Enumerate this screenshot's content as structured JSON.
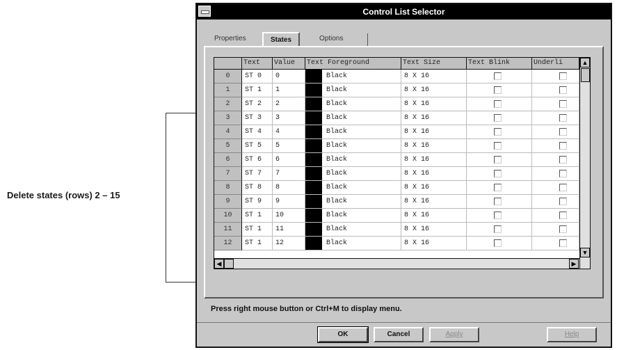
{
  "annotation": {
    "label": "Delete states (rows) 2 – 15"
  },
  "window": {
    "title": "Control List Selector"
  },
  "tabs": [
    {
      "label": "Properties"
    },
    {
      "label": "States"
    },
    {
      "label": "Options"
    }
  ],
  "grid": {
    "columns": [
      "Text",
      "Value",
      "Text Foreground",
      "Text Size",
      "Text Blink",
      "Underli"
    ],
    "rows": [
      {
        "index": "0",
        "text": "ST 0",
        "value": "0",
        "fg": "Black",
        "size": "8 X 16"
      },
      {
        "index": "1",
        "text": "ST 1",
        "value": "1",
        "fg": "Black",
        "size": "8 X 16"
      },
      {
        "index": "2",
        "text": "ST 2",
        "value": "2",
        "fg": "Black",
        "size": "8 X 16"
      },
      {
        "index": "3",
        "text": "ST 3",
        "value": "3",
        "fg": "Black",
        "size": "8 X 16"
      },
      {
        "index": "4",
        "text": "ST 4",
        "value": "4",
        "fg": "Black",
        "size": "8 X 16"
      },
      {
        "index": "5",
        "text": "ST 5",
        "value": "5",
        "fg": "Black",
        "size": "8 X 16"
      },
      {
        "index": "6",
        "text": "ST 6",
        "value": "6",
        "fg": "Black",
        "size": "8 X 16"
      },
      {
        "index": "7",
        "text": "ST 7",
        "value": "7",
        "fg": "Black",
        "size": "8 X 16"
      },
      {
        "index": "8",
        "text": "ST 8",
        "value": "8",
        "fg": "Black",
        "size": "8 X 16"
      },
      {
        "index": "9",
        "text": "ST 9",
        "value": "9",
        "fg": "Black",
        "size": "8 X 16"
      },
      {
        "index": "10",
        "text": "ST 1",
        "value": "10",
        "fg": "Black",
        "size": "8 X 16"
      },
      {
        "index": "11",
        "text": "ST 1",
        "value": "11",
        "fg": "Black",
        "size": "8 X 16"
      },
      {
        "index": "12",
        "text": "ST 1",
        "value": "12",
        "fg": "Black",
        "size": "8 X 16"
      }
    ]
  },
  "scroll": {
    "up_icon": "arrow-up-icon",
    "down_icon": "arrow-down-icon",
    "left_icon": "arrow-left-icon",
    "right_icon": "arrow-right-icon"
  },
  "status": "Press right mouse button or Ctrl+M to display menu.",
  "buttons": {
    "ok": "OK",
    "cancel": "Cancel",
    "apply": "Apply",
    "help": "Help"
  },
  "colors": {
    "titlebar": "#000000",
    "dialog_face": "#c8c8c8",
    "foreground_swatch": "#000000"
  }
}
